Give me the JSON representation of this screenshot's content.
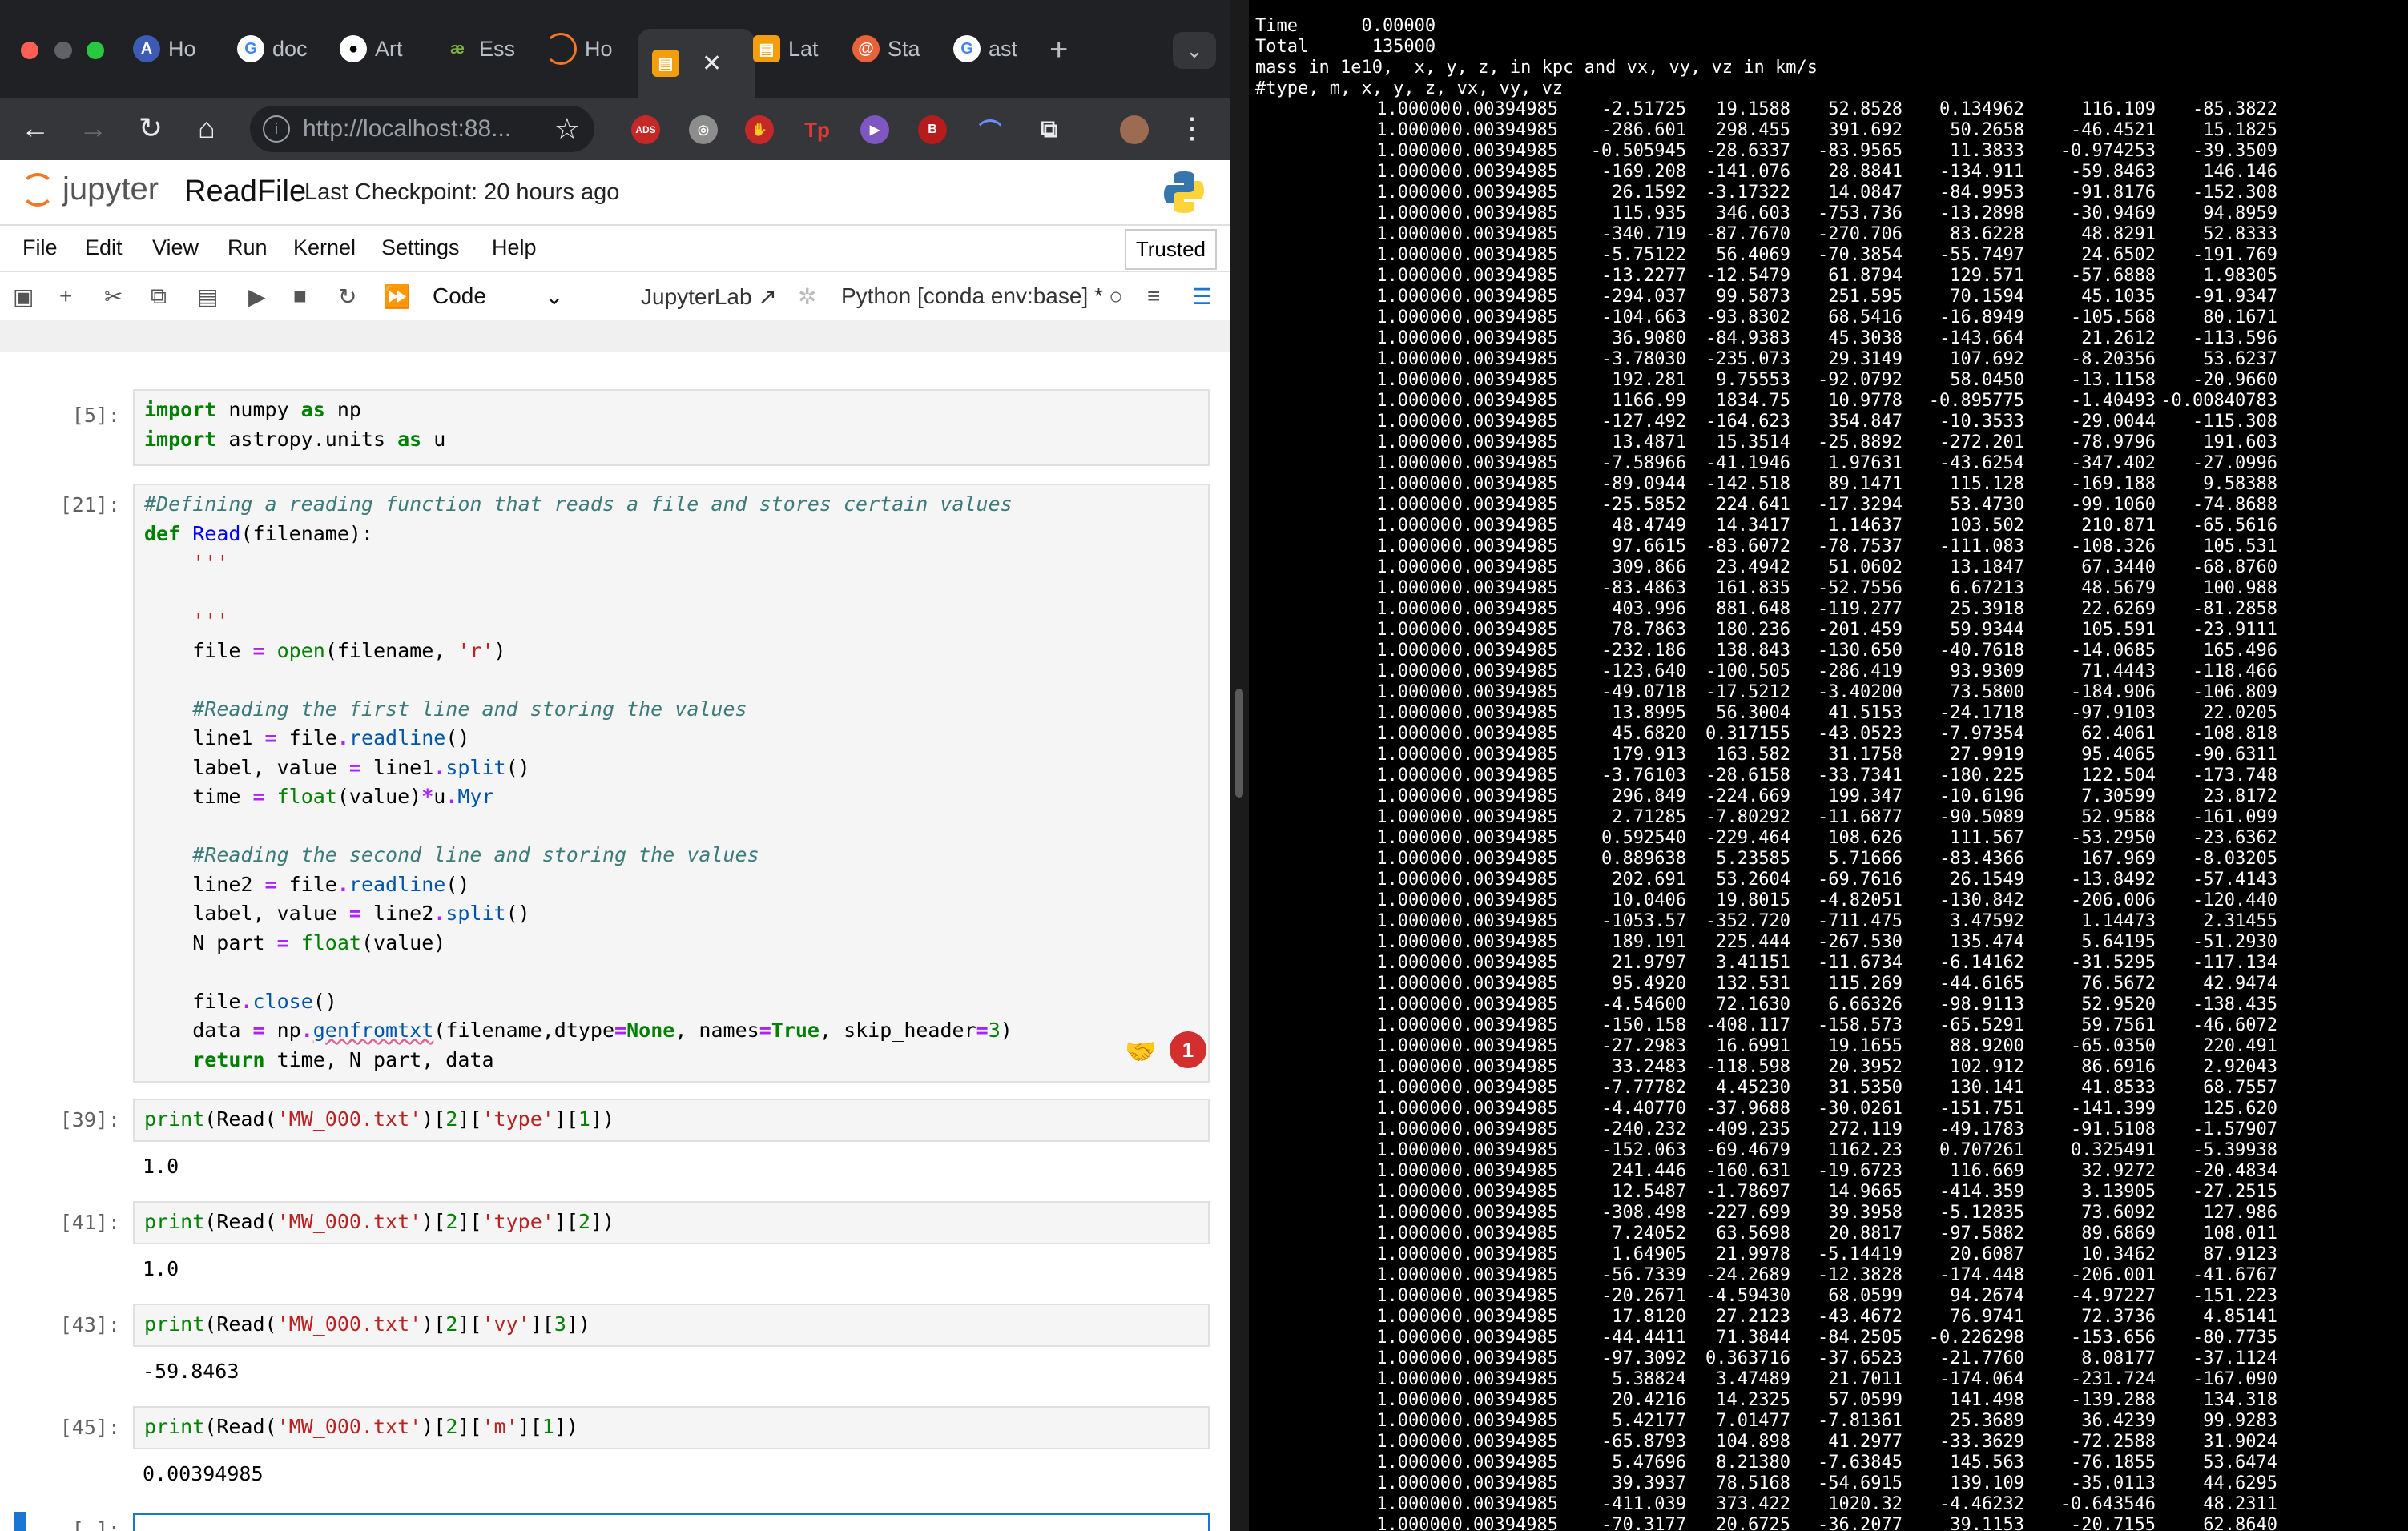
{
  "browser": {
    "tabs": [
      {
        "icon": "arizona-icon",
        "label": "Ho"
      },
      {
        "icon": "google-icon",
        "label": "doc"
      },
      {
        "icon": "github-icon",
        "label": "Art"
      },
      {
        "icon": "ess-icon",
        "label": "Ess"
      },
      {
        "icon": "jupyter-icon",
        "label": "Ho"
      },
      {
        "icon": "notebook-icon",
        "label": ""
      },
      {
        "icon": "notebook-icon",
        "label": "Lat"
      },
      {
        "icon": "star-icon",
        "label": "Sta"
      },
      {
        "icon": "google-icon",
        "label": "ast"
      }
    ],
    "url": "http://localhost:88...",
    "extensions": [
      "ADS",
      "Tp",
      "B"
    ]
  },
  "jupyter": {
    "brand": "jupyter",
    "notebook_name": "ReadFile",
    "checkpoint": "Last Checkpoint: 20 hours ago",
    "menu": [
      "File",
      "Edit",
      "View",
      "Run",
      "Kernel",
      "Settings",
      "Help"
    ],
    "trusted": "Trusted",
    "cell_type": "Code",
    "jupyterlab_link": "JupyterLab",
    "kernel": "Python [conda env:base] *"
  },
  "cells": [
    {
      "prompt": "[5]:"
    },
    {
      "prompt": "[21]:"
    },
    {
      "prompt": "[39]:",
      "output": "1.0"
    },
    {
      "prompt": "[41]:",
      "output": "1.0"
    },
    {
      "prompt": "[43]:",
      "output": "-59.8463"
    },
    {
      "prompt": "[45]:",
      "output": "0.00394985"
    },
    {
      "prompt": "[ ]:"
    }
  ],
  "comment_badge": "1",
  "terminal": {
    "header": [
      "Time      0.00000",
      "Total      135000",
      "mass in 1e10,  x, y, z, in kpc and vx, vy, vz in km/s",
      "#type, m, x, y, z, vx, vy, vz"
    ],
    "rows": [
      [
        "1.00000",
        "0.00394985",
        "-2.51725",
        "19.1588",
        "52.8528",
        "0.134962",
        "116.109",
        "-85.3822"
      ],
      [
        "1.00000",
        "0.00394985",
        "-286.601",
        "298.455",
        "391.692",
        "50.2658",
        "-46.4521",
        "15.1825"
      ],
      [
        "1.00000",
        "0.00394985",
        "-0.505945",
        "-28.6337",
        "-83.9565",
        "11.3833",
        "-0.974253",
        "-39.3509"
      ],
      [
        "1.00000",
        "0.00394985",
        "-169.208",
        "-141.076",
        "28.8841",
        "-134.911",
        "-59.8463",
        "146.146"
      ],
      [
        "1.00000",
        "0.00394985",
        "26.1592",
        "-3.17322",
        "14.0847",
        "-84.9953",
        "-91.8176",
        "-152.308"
      ],
      [
        "1.00000",
        "0.00394985",
        "115.935",
        "346.603",
        "-753.736",
        "-13.2898",
        "-30.9469",
        "94.8959"
      ],
      [
        "1.00000",
        "0.00394985",
        "-340.719",
        "-87.7670",
        "-270.706",
        "83.6228",
        "48.8291",
        "52.8333"
      ],
      [
        "1.00000",
        "0.00394985",
        "-5.75122",
        "56.4069",
        "-70.3854",
        "-55.7497",
        "24.6502",
        "-191.769"
      ],
      [
        "1.00000",
        "0.00394985",
        "-13.2277",
        "-12.5479",
        "61.8794",
        "129.571",
        "-57.6888",
        "1.98305"
      ],
      [
        "1.00000",
        "0.00394985",
        "-294.037",
        "99.5873",
        "251.595",
        "70.1594",
        "45.1035",
        "-91.9347"
      ],
      [
        "1.00000",
        "0.00394985",
        "-104.663",
        "-93.8302",
        "68.5416",
        "-16.8949",
        "-105.568",
        "80.1671"
      ],
      [
        "1.00000",
        "0.00394985",
        "36.9080",
        "-84.9383",
        "45.3038",
        "-143.664",
        "21.2612",
        "-113.596"
      ],
      [
        "1.00000",
        "0.00394985",
        "-3.78030",
        "-235.073",
        "29.3149",
        "107.692",
        "-8.20356",
        "53.6237"
      ],
      [
        "1.00000",
        "0.00394985",
        "192.281",
        "9.75553",
        "-92.0792",
        "58.0450",
        "-13.1158",
        "-20.9660"
      ],
      [
        "1.00000",
        "0.00394985",
        "1166.99",
        "1834.75",
        "10.9778",
        "-0.895775",
        "-1.40493",
        "-0.00840783"
      ],
      [
        "1.00000",
        "0.00394985",
        "-127.492",
        "-164.623",
        "354.847",
        "-10.3533",
        "-29.0044",
        "-115.308"
      ],
      [
        "1.00000",
        "0.00394985",
        "13.4871",
        "15.3514",
        "-25.8892",
        "-272.201",
        "-78.9796",
        "191.603"
      ],
      [
        "1.00000",
        "0.00394985",
        "-7.58966",
        "-41.1946",
        "1.97631",
        "-43.6254",
        "-347.402",
        "-27.0996"
      ],
      [
        "1.00000",
        "0.00394985",
        "-89.0944",
        "-142.518",
        "89.1471",
        "115.128",
        "-169.188",
        "9.58388"
      ],
      [
        "1.00000",
        "0.00394985",
        "-25.5852",
        "224.641",
        "-17.3294",
        "53.4730",
        "-99.1060",
        "-74.8688"
      ],
      [
        "1.00000",
        "0.00394985",
        "48.4749",
        "14.3417",
        "1.14637",
        "103.502",
        "210.871",
        "-65.5616"
      ],
      [
        "1.00000",
        "0.00394985",
        "97.6615",
        "-83.6072",
        "-78.7537",
        "-111.083",
        "-108.326",
        "105.531"
      ],
      [
        "1.00000",
        "0.00394985",
        "309.866",
        "23.4942",
        "51.0602",
        "13.1847",
        "67.3440",
        "-68.8760"
      ],
      [
        "1.00000",
        "0.00394985",
        "-83.4863",
        "161.835",
        "-52.7556",
        "6.67213",
        "48.5679",
        "100.988"
      ],
      [
        "1.00000",
        "0.00394985",
        "403.996",
        "881.648",
        "-119.277",
        "25.3918",
        "22.6269",
        "-81.2858"
      ],
      [
        "1.00000",
        "0.00394985",
        "78.7863",
        "180.236",
        "-201.459",
        "59.9344",
        "105.591",
        "-23.9111"
      ],
      [
        "1.00000",
        "0.00394985",
        "-232.186",
        "138.843",
        "-130.650",
        "-40.7618",
        "-14.0685",
        "165.496"
      ],
      [
        "1.00000",
        "0.00394985",
        "-123.640",
        "-100.505",
        "-286.419",
        "93.9309",
        "71.4443",
        "-118.466"
      ],
      [
        "1.00000",
        "0.00394985",
        "-49.0718",
        "-17.5212",
        "-3.40200",
        "73.5800",
        "-184.906",
        "-106.809"
      ],
      [
        "1.00000",
        "0.00394985",
        "13.8995",
        "56.3004",
        "41.5153",
        "-24.1718",
        "-97.9103",
        "22.0205"
      ],
      [
        "1.00000",
        "0.00394985",
        "45.6820",
        "0.317155",
        "-43.0523",
        "-7.97354",
        "62.4061",
        "-108.818"
      ],
      [
        "1.00000",
        "0.00394985",
        "179.913",
        "163.582",
        "31.1758",
        "27.9919",
        "95.4065",
        "-90.6311"
      ],
      [
        "1.00000",
        "0.00394985",
        "-3.76103",
        "-28.6158",
        "-33.7341",
        "-180.225",
        "122.504",
        "-173.748"
      ],
      [
        "1.00000",
        "0.00394985",
        "296.849",
        "-224.669",
        "199.347",
        "-10.6196",
        "7.30599",
        "23.8172"
      ],
      [
        "1.00000",
        "0.00394985",
        "2.71285",
        "-7.80292",
        "-11.6877",
        "-90.5089",
        "52.9588",
        "-161.099"
      ],
      [
        "1.00000",
        "0.00394985",
        "0.592540",
        "-229.464",
        "108.626",
        "111.567",
        "-53.2950",
        "-23.6362"
      ],
      [
        "1.00000",
        "0.00394985",
        "0.889638",
        "5.23585",
        "5.71666",
        "-83.4366",
        "167.969",
        "-8.03205"
      ],
      [
        "1.00000",
        "0.00394985",
        "202.691",
        "53.2604",
        "-69.7616",
        "26.1549",
        "-13.8492",
        "-57.4143"
      ],
      [
        "1.00000",
        "0.00394985",
        "10.0406",
        "19.8015",
        "-4.82051",
        "-130.842",
        "-206.006",
        "-120.440"
      ],
      [
        "1.00000",
        "0.00394985",
        "-1053.57",
        "-352.720",
        "-711.475",
        "3.47592",
        "1.14473",
        "2.31455"
      ],
      [
        "1.00000",
        "0.00394985",
        "189.191",
        "225.444",
        "-267.530",
        "135.474",
        "5.64195",
        "-51.2930"
      ],
      [
        "1.00000",
        "0.00394985",
        "21.9797",
        "3.41151",
        "-11.6734",
        "-6.14162",
        "-31.5295",
        "-117.134"
      ],
      [
        "1.00000",
        "0.00394985",
        "95.4920",
        "132.531",
        "115.269",
        "-44.6165",
        "76.5672",
        "42.9474"
      ],
      [
        "1.00000",
        "0.00394985",
        "-4.54600",
        "72.1630",
        "6.66326",
        "-98.9113",
        "52.9520",
        "-138.435"
      ],
      [
        "1.00000",
        "0.00394985",
        "-150.158",
        "-408.117",
        "-158.573",
        "-65.5291",
        "59.7561",
        "-46.6072"
      ],
      [
        "1.00000",
        "0.00394985",
        "-27.2983",
        "16.6991",
        "19.1655",
        "88.9200",
        "-65.0350",
        "220.491"
      ],
      [
        "1.00000",
        "0.00394985",
        "33.2483",
        "-118.598",
        "20.3952",
        "102.912",
        "86.6916",
        "2.92043"
      ],
      [
        "1.00000",
        "0.00394985",
        "-7.77782",
        "4.45230",
        "31.5350",
        "130.141",
        "41.8533",
        "68.7557"
      ],
      [
        "1.00000",
        "0.00394985",
        "-4.40770",
        "-37.9688",
        "-30.0261",
        "-151.751",
        "-141.399",
        "125.620"
      ],
      [
        "1.00000",
        "0.00394985",
        "-240.232",
        "-409.235",
        "272.119",
        "-49.1783",
        "-91.5108",
        "-1.57907"
      ],
      [
        "1.00000",
        "0.00394985",
        "-152.063",
        "-69.4679",
        "1162.23",
        "0.707261",
        "0.325491",
        "-5.39938"
      ],
      [
        "1.00000",
        "0.00394985",
        "241.446",
        "-160.631",
        "-19.6723",
        "116.669",
        "32.9272",
        "-20.4834"
      ],
      [
        "1.00000",
        "0.00394985",
        "12.5487",
        "-1.78697",
        "14.9665",
        "-414.359",
        "3.13905",
        "-27.2515"
      ],
      [
        "1.00000",
        "0.00394985",
        "-308.498",
        "-227.699",
        "39.3958",
        "-5.12835",
        "73.6092",
        "127.986"
      ],
      [
        "1.00000",
        "0.00394985",
        "7.24052",
        "63.5698",
        "20.8817",
        "-97.5882",
        "89.6869",
        "108.011"
      ],
      [
        "1.00000",
        "0.00394985",
        "1.64905",
        "21.9978",
        "-5.14419",
        "20.6087",
        "10.3462",
        "87.9123"
      ],
      [
        "1.00000",
        "0.00394985",
        "-56.7339",
        "-24.2689",
        "-12.3828",
        "-174.448",
        "-206.001",
        "-41.6767"
      ],
      [
        "1.00000",
        "0.00394985",
        "-20.2671",
        "-4.59430",
        "68.0599",
        "94.2674",
        "-4.97227",
        "-151.223"
      ],
      [
        "1.00000",
        "0.00394985",
        "17.8120",
        "27.2123",
        "-43.4672",
        "76.9741",
        "72.3736",
        "4.85141"
      ],
      [
        "1.00000",
        "0.00394985",
        "-44.4411",
        "71.3844",
        "-84.2505",
        "-0.226298",
        "-153.656",
        "-80.7735"
      ],
      [
        "1.00000",
        "0.00394985",
        "-97.3092",
        "0.363716",
        "-37.6523",
        "-21.7760",
        "8.08177",
        "-37.1124"
      ],
      [
        "1.00000",
        "0.00394985",
        "5.38824",
        "3.47489",
        "21.7011",
        "-174.064",
        "-231.724",
        "-167.090"
      ],
      [
        "1.00000",
        "0.00394985",
        "20.4216",
        "14.2325",
        "57.0599",
        "141.498",
        "-139.288",
        "134.318"
      ],
      [
        "1.00000",
        "0.00394985",
        "5.42177",
        "7.01477",
        "-7.81361",
        "25.3689",
        "36.4239",
        "99.9283"
      ],
      [
        "1.00000",
        "0.00394985",
        "-65.8793",
        "104.898",
        "41.2977",
        "-33.3629",
        "-72.2588",
        "31.9024"
      ],
      [
        "1.00000",
        "0.00394985",
        "5.47696",
        "8.21380",
        "-7.63845",
        "145.563",
        "-76.1855",
        "53.6474"
      ],
      [
        "1.00000",
        "0.00394985",
        "39.3937",
        "78.5168",
        "-54.6915",
        "139.109",
        "-35.0113",
        "44.6295"
      ],
      [
        "1.00000",
        "0.00394985",
        "-411.039",
        "373.422",
        "1020.32",
        "-4.46232",
        "-0.643546",
        "48.2311"
      ],
      [
        "1.00000",
        "0.00394985",
        "-70.3177",
        "20.6725",
        "-36.2077",
        "39.1153",
        "-20.7155",
        "62.8640"
      ]
    ]
  }
}
